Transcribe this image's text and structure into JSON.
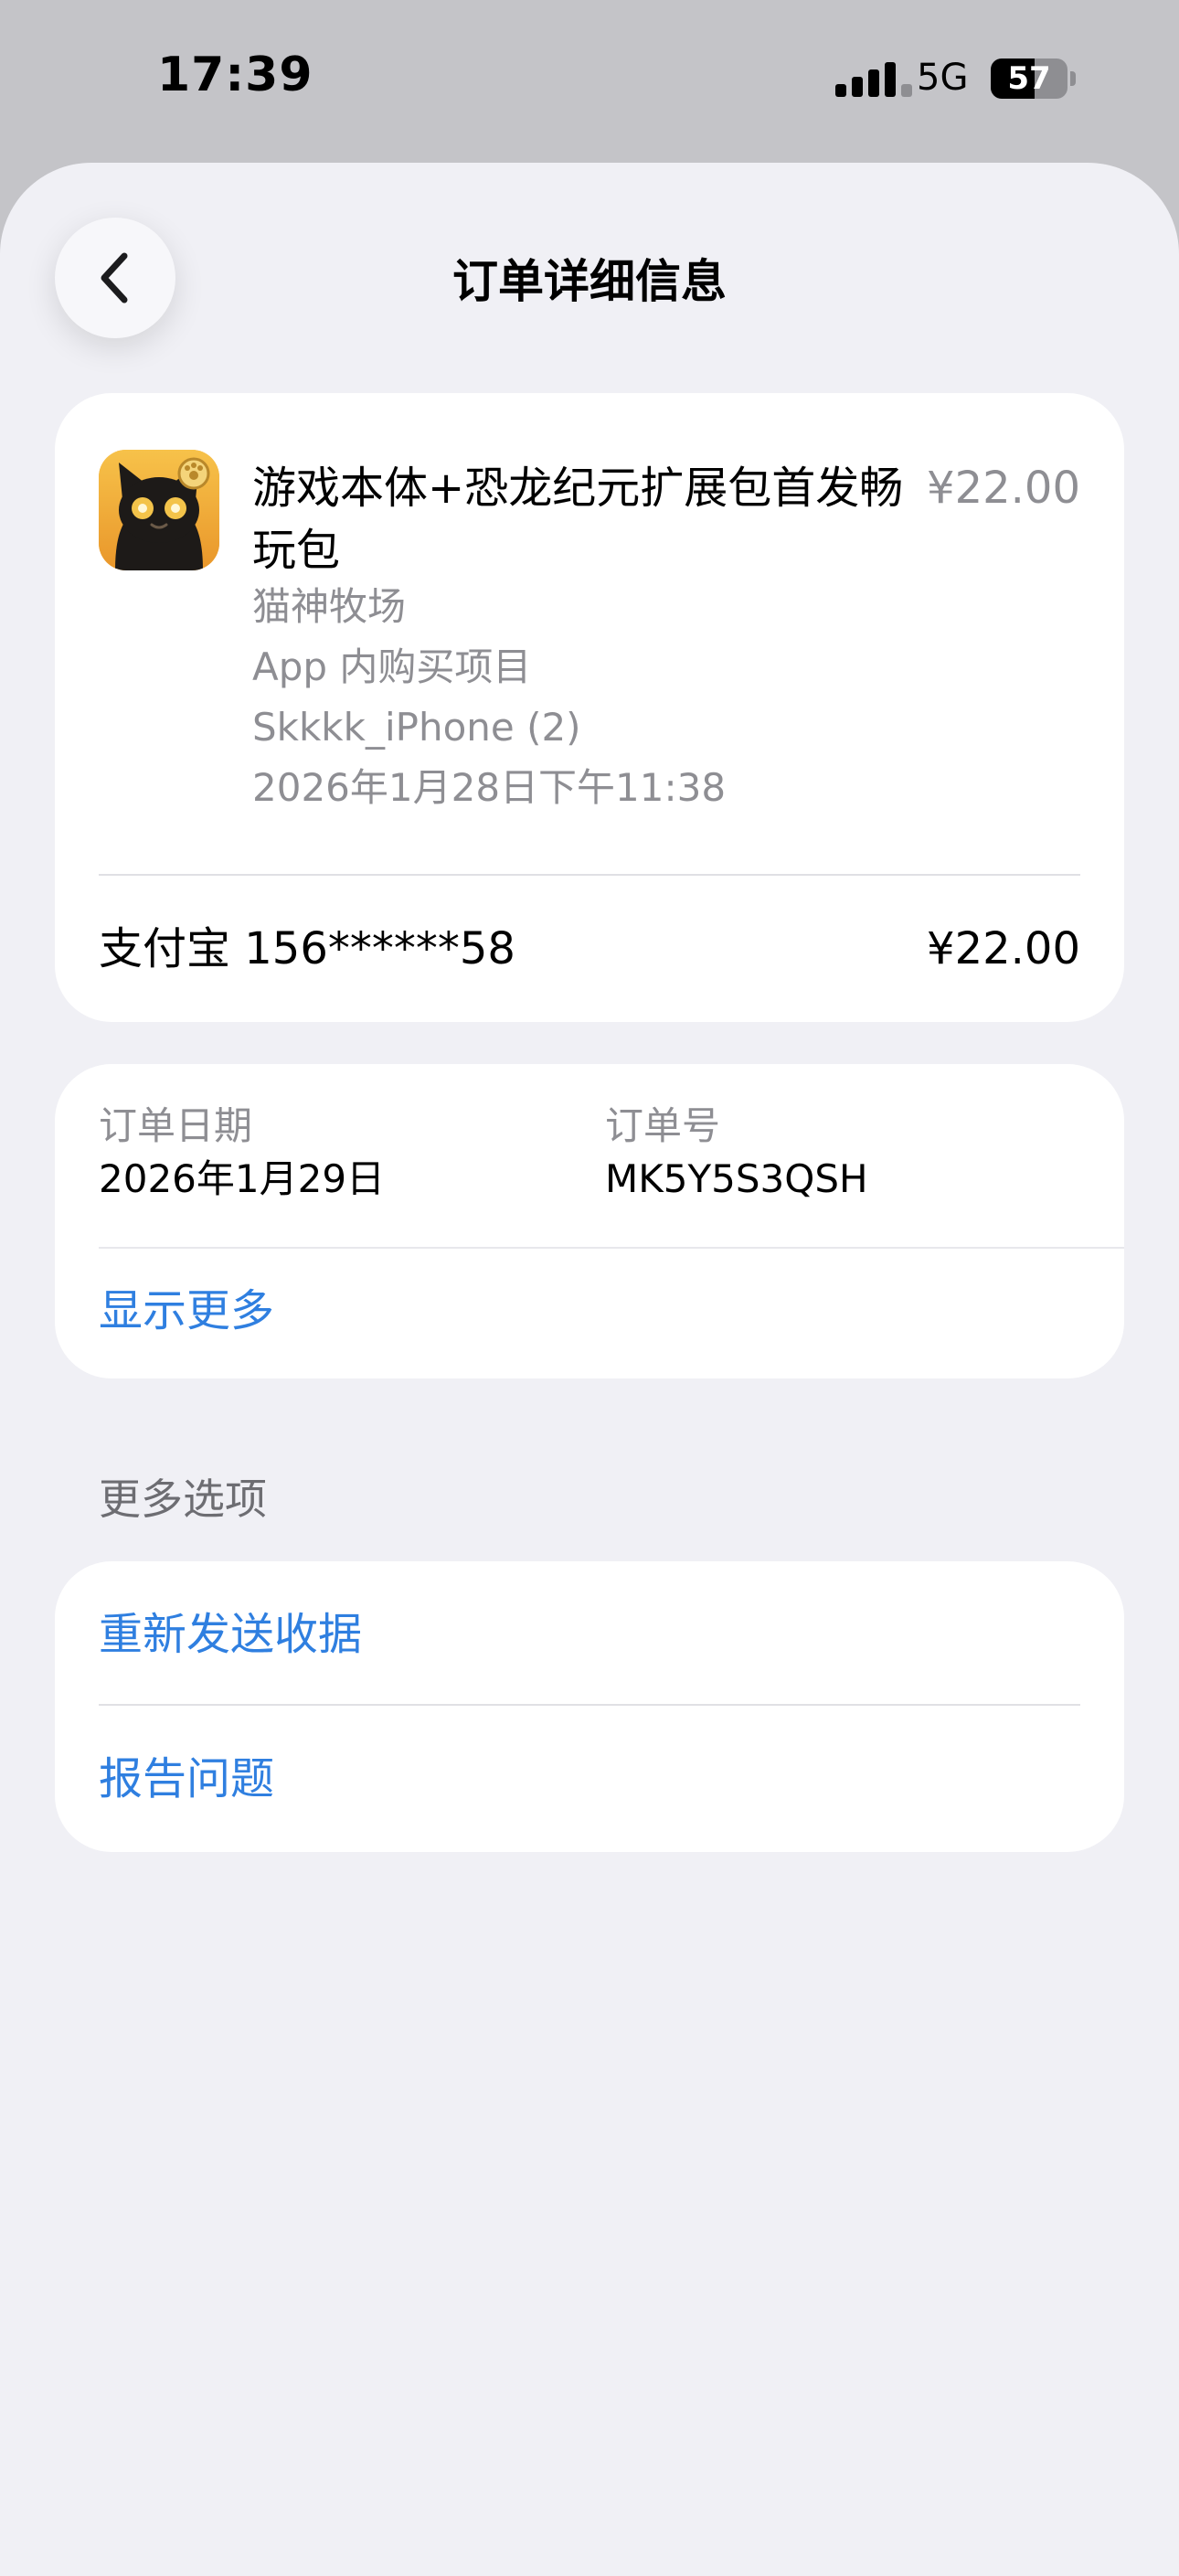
{
  "status_bar": {
    "time": "17:39",
    "network": "5G",
    "battery_level": "57",
    "battery_fraction": 0.57
  },
  "nav": {
    "title": "订单详细信息",
    "back_icon": "chevron-left-icon"
  },
  "purchase": {
    "item_title": "游戏本体+恐龙纪元扩展包首发畅玩包",
    "price": "¥22.00",
    "seller": "猫神牧场",
    "purchase_type": "App 内购买项目",
    "device": "Skkkk_iPhone (2)",
    "date": "2026年1月28日下午11:38",
    "payment_method": "支付宝 156******58",
    "payment_amount": "¥22.00",
    "app_icon": "black-cat-app-icon"
  },
  "order_info": {
    "date_label": "订单日期",
    "date_value": "2026年1月29日",
    "number_label": "订单号",
    "number_value": "MK5Y5S3QSH",
    "show_more": "显示更多"
  },
  "more_options": {
    "header": "更多选项",
    "resend_receipt": "重新发送收据",
    "report_problem": "报告问题"
  },
  "colors": {
    "accent": "#2f7fe0",
    "secondary_text": "#8e8e93",
    "background": "#f0f0f5"
  }
}
